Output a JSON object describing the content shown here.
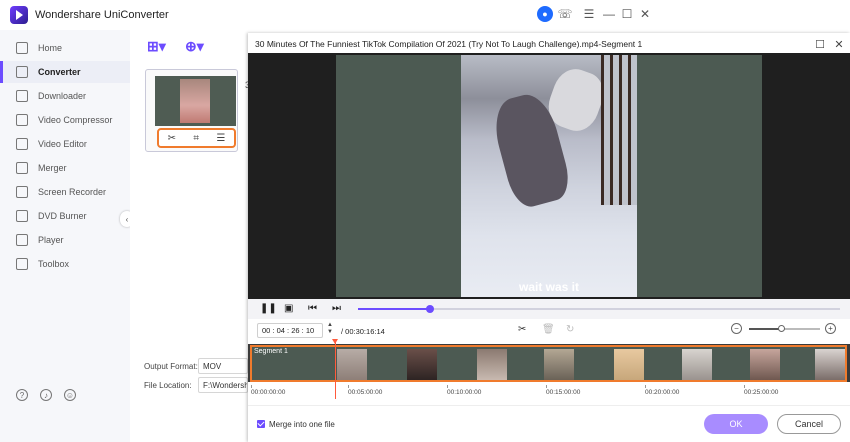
{
  "app": {
    "title": "Wondershare UniConverter"
  },
  "sidebar": {
    "items": [
      {
        "label": "Home",
        "icon": "home-icon"
      },
      {
        "label": "Converter",
        "icon": "converter-icon"
      },
      {
        "label": "Downloader",
        "icon": "downloader-icon"
      },
      {
        "label": "Video Compressor",
        "icon": "compress-icon"
      },
      {
        "label": "Video Editor",
        "icon": "video-editor-icon"
      },
      {
        "label": "Merger",
        "icon": "merger-icon"
      },
      {
        "label": "Screen Recorder",
        "icon": "screen-recorder-icon"
      },
      {
        "label": "DVD Burner",
        "icon": "dvd-icon"
      },
      {
        "label": "Player",
        "icon": "player-icon"
      },
      {
        "label": "Toolbox",
        "icon": "toolbox-icon"
      }
    ],
    "active": "Converter"
  },
  "converter": {
    "card_suffix": "3",
    "output_format_label": "Output Format:",
    "output_format_value": "MOV",
    "file_location_label": "File Location:",
    "file_location_value": "F:\\Wondershare"
  },
  "dialog": {
    "title": "30 Minutes Of The Funniest TikTok Compilation Of 2021 (Try Not To Laugh Challenge).mp4-Segment 1",
    "caption": "wait was it",
    "progress_fraction": 0.15,
    "current_time": {
      "hh": "00",
      "mm": "04",
      "ss": "26",
      "ff": "10"
    },
    "total_time": "/ 00:30:16:14",
    "zoom_fraction": 0.45,
    "segment_label": "Segment 1",
    "ruler": [
      "00:00:00:00",
      "00:05:00:00",
      "00:10:00:00",
      "00:15:00:00",
      "00:20:00:00",
      "00:25:00:00"
    ],
    "merge_label": "Merge into one file",
    "merge_checked": true,
    "ok_label": "OK",
    "cancel_label": "Cancel"
  },
  "colors": {
    "accent": "#6c4cff",
    "highlight": "#f07b2d",
    "ok_button": "#a88cff"
  }
}
